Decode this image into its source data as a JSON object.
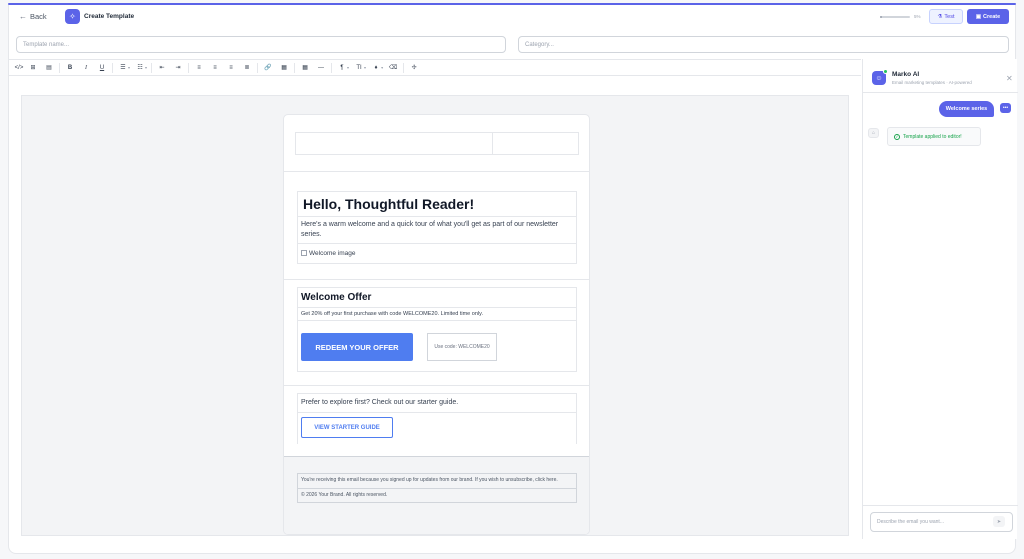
{
  "header": {
    "back_label": "Back",
    "back_icon": "←",
    "logo_icon": "✧",
    "title": "Create Template",
    "zoom_label": "5%",
    "test_label": "Test",
    "test_icon": "⚗",
    "create_label": "Create",
    "create_icon": "▣"
  },
  "fields": {
    "name_placeholder": "Template name...",
    "category_placeholder": "Category..."
  },
  "toolbar": {
    "code": "</>",
    "source": "⊞",
    "preview": "▤",
    "bold": "B",
    "italic": "I",
    "underline": "U",
    "bullets": "☰",
    "numbered": "☷",
    "outdent": "⇤",
    "indent": "⇥",
    "align_left": "≡",
    "align_center": "≡",
    "align_right": "≡",
    "justify": "≣",
    "link": "🔗",
    "image": "▦",
    "table": "▦",
    "hr": "—",
    "paragraph": "¶",
    "font_size": "TI",
    "color": "♦",
    "clear": "⌫",
    "ai": "✢",
    "caret": "▾"
  },
  "email": {
    "greeting": "Hello, Thoughtful Reader!",
    "intro": "Here's a warm welcome and a quick tour of what you'll get as part of our newsletter series.",
    "image_alt": "Welcome image",
    "offer_title": "Welcome Offer",
    "offer_text": "Get 20% off your first purchase with code WELCOME20. Limited time only.",
    "redeem_label": "REDEEM YOUR OFFER",
    "code_label": "Use code: WELCOME20",
    "explore_text": "Prefer to explore first? Check out our starter guide.",
    "starter_label": "VIEW STARTER GUIDE",
    "footer_notice": "You're receiving this email because you signed up for updates from our brand. If you wish to unsubscribe, click here.",
    "copyright": "© 2026 Your Brand. All rights reserved."
  },
  "panel": {
    "bot_icon": "☺",
    "name": "Marko AI",
    "subtitle": "Email marketing templates · AI-powered",
    "close_icon": "✕",
    "user_message": "Welcome series",
    "user_icon": "•••",
    "assistant_icon": "⌂",
    "assistant_message": "Template applied to editor!",
    "ok_icon": "✓",
    "input_placeholder": "Describe the email you want...",
    "send_icon": "➤"
  },
  "colors": {
    "accent": "#5b63e8",
    "button_blue": "#4f7df0",
    "success": "#16a34a"
  }
}
